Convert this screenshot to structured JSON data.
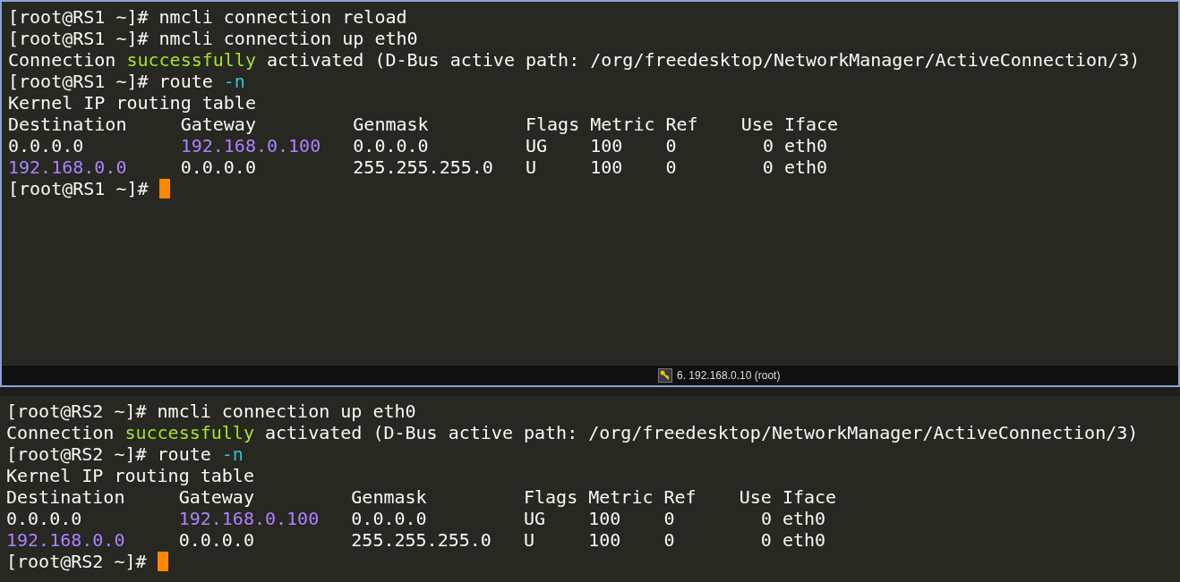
{
  "panes": [
    {
      "active": true,
      "lines": [
        {
          "cursor": false,
          "segments": [
            {
              "kind": "plain",
              "text": "[root@RS1 ~]# nmcli connection reload"
            }
          ]
        },
        {
          "cursor": false,
          "segments": [
            {
              "kind": "plain",
              "text": "[root@RS1 ~]# nmcli connection up eth0"
            }
          ]
        },
        {
          "cursor": false,
          "segments": [
            {
              "kind": "plain",
              "text": "Connection "
            },
            {
              "kind": "success",
              "text": "successfully"
            },
            {
              "kind": "plain",
              "text": " activated (D-Bus active path: /org/freedesktop/NetworkManager/ActiveConnection/3)"
            }
          ]
        },
        {
          "cursor": false,
          "segments": [
            {
              "kind": "plain",
              "text": "[root@RS1 ~]# route "
            },
            {
              "kind": "option",
              "text": "-n"
            }
          ]
        },
        {
          "cursor": false,
          "segments": [
            {
              "kind": "plain",
              "text": "Kernel IP routing table"
            }
          ]
        },
        {
          "cursor": false,
          "segments": [
            {
              "kind": "plain",
              "text": "Destination     Gateway         Genmask         Flags Metric Ref    Use Iface"
            }
          ]
        },
        {
          "cursor": false,
          "segments": [
            {
              "kind": "plain",
              "text": "0.0.0.0         "
            },
            {
              "kind": "address",
              "text": "192.168.0.100"
            },
            {
              "kind": "plain",
              "text": "   0.0.0.0         UG    100    0        0 eth0"
            }
          ]
        },
        {
          "cursor": false,
          "segments": [
            {
              "kind": "address",
              "text": "192.168.0.0"
            },
            {
              "kind": "plain",
              "text": "     0.0.0.0         255.255.255.0   U     100    0        0 eth0"
            }
          ]
        },
        {
          "cursor": true,
          "segments": [
            {
              "kind": "plain",
              "text": "[root@RS1 ~]# "
            }
          ]
        }
      ],
      "status_bar": {
        "text": "6. 192.168.0.10 (root)"
      }
    },
    {
      "active": false,
      "lines": [
        {
          "cursor": false,
          "segments": [
            {
              "kind": "plain",
              "text": "[root@RS2 ~]# nmcli connection up eth0"
            }
          ]
        },
        {
          "cursor": false,
          "segments": [
            {
              "kind": "plain",
              "text": "Connection "
            },
            {
              "kind": "success",
              "text": "successfully"
            },
            {
              "kind": "plain",
              "text": " activated (D-Bus active path: /org/freedesktop/NetworkManager/ActiveConnection/3)"
            }
          ]
        },
        {
          "cursor": false,
          "segments": [
            {
              "kind": "plain",
              "text": "[root@RS2 ~]# route "
            },
            {
              "kind": "option",
              "text": "-n"
            }
          ]
        },
        {
          "cursor": false,
          "segments": [
            {
              "kind": "plain",
              "text": "Kernel IP routing table"
            }
          ]
        },
        {
          "cursor": false,
          "segments": [
            {
              "kind": "plain",
              "text": "Destination     Gateway         Genmask         Flags Metric Ref    Use Iface"
            }
          ]
        },
        {
          "cursor": false,
          "segments": [
            {
              "kind": "plain",
              "text": "0.0.0.0         "
            },
            {
              "kind": "address",
              "text": "192.168.0.100"
            },
            {
              "kind": "plain",
              "text": "   0.0.0.0         UG    100    0        0 eth0"
            }
          ]
        },
        {
          "cursor": false,
          "segments": [
            {
              "kind": "address",
              "text": "192.168.0.0"
            },
            {
              "kind": "plain",
              "text": "     0.0.0.0         255.255.255.0   U     100    0        0 eth0"
            }
          ]
        },
        {
          "cursor": true,
          "segments": [
            {
              "kind": "plain",
              "text": "[root@RS2 ~]# "
            }
          ]
        }
      ]
    }
  ]
}
